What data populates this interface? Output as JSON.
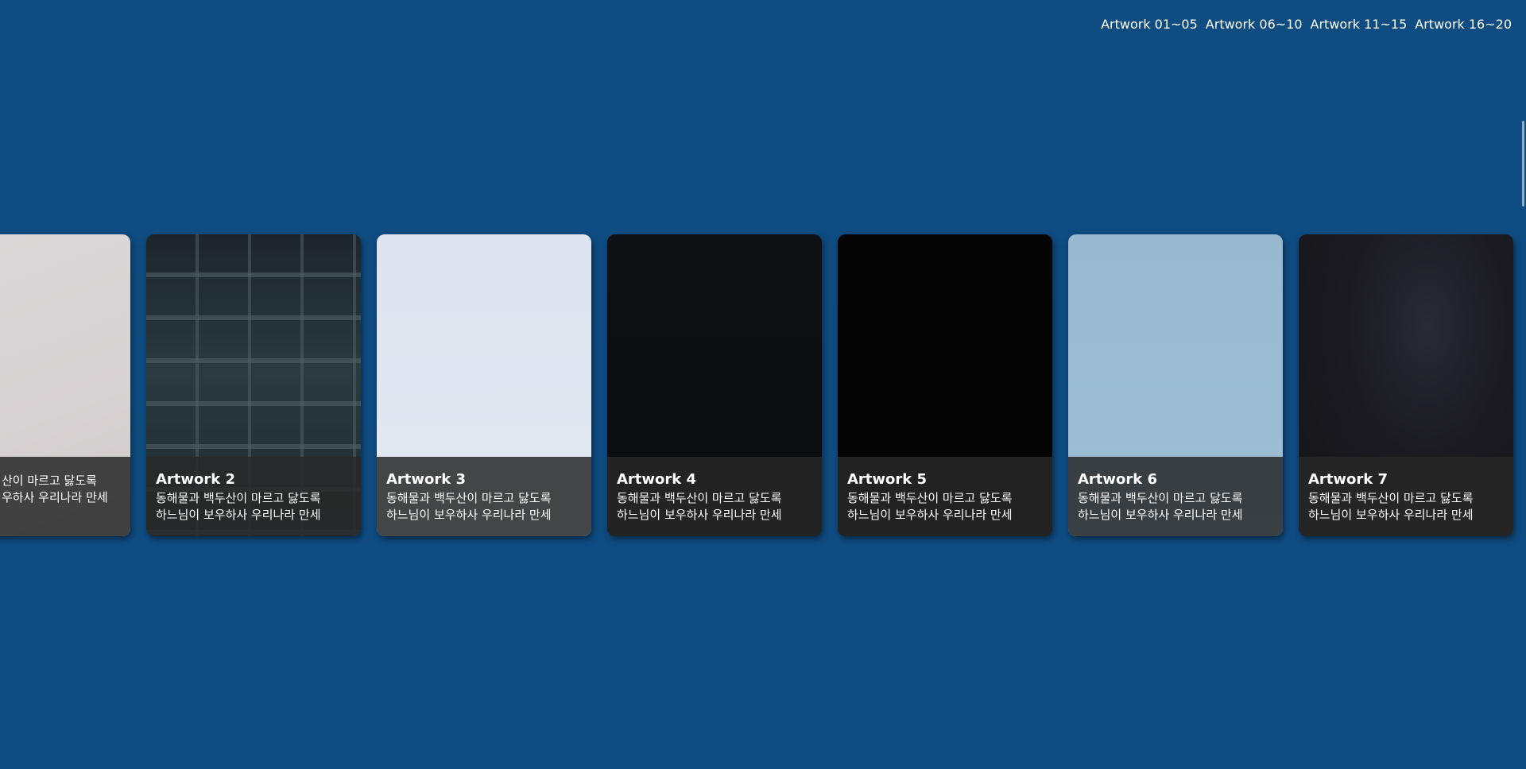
{
  "nav": {
    "links": [
      "Artwork 01~05",
      "Artwork 06~10",
      "Artwork 11~15",
      "Artwork 16~20"
    ]
  },
  "cards": [
    {
      "title": "",
      "line1": "산이 마르고 닳도록",
      "line2": "우하사 우리나라 만세",
      "image": "pale-grey-texture"
    },
    {
      "title": "Artwork 2",
      "line1": "동해물과 백두산이 마르고 닳도록",
      "line2": "하느님이 보우하사 우리나라 만세",
      "image": "dark-building-windows"
    },
    {
      "title": "Artwork 3",
      "line1": "동해물과 백두산이 마르고 닳도록",
      "line2": "하느님이 보우하사 우리나라 만세",
      "image": "pale-sky"
    },
    {
      "title": "Artwork 4",
      "line1": "동해물과 백두산이 마르고 닳도록",
      "line2": "하느님이 보우하사 우리나라 만세",
      "image": "near-black"
    },
    {
      "title": "Artwork 5",
      "line1": "동해물과 백두산이 마르고 닳도록",
      "line2": "하느님이 보우하사 우리나라 만세",
      "image": "black"
    },
    {
      "title": "Artwork 6",
      "line1": "동해물과 백두산이 마르고 닳도록",
      "line2": "하느님이 보우하사 우리나라 만세",
      "image": "light-blue-sky"
    },
    {
      "title": "Artwork 7",
      "line1": "동해물과 백두산이 마르고 닳도록",
      "line2": "하느님이 보우하사 우리나라 만세",
      "image": "dark-night-scene"
    }
  ],
  "colors": {
    "background": "#0f4c82",
    "caption_overlay": "#282828"
  }
}
